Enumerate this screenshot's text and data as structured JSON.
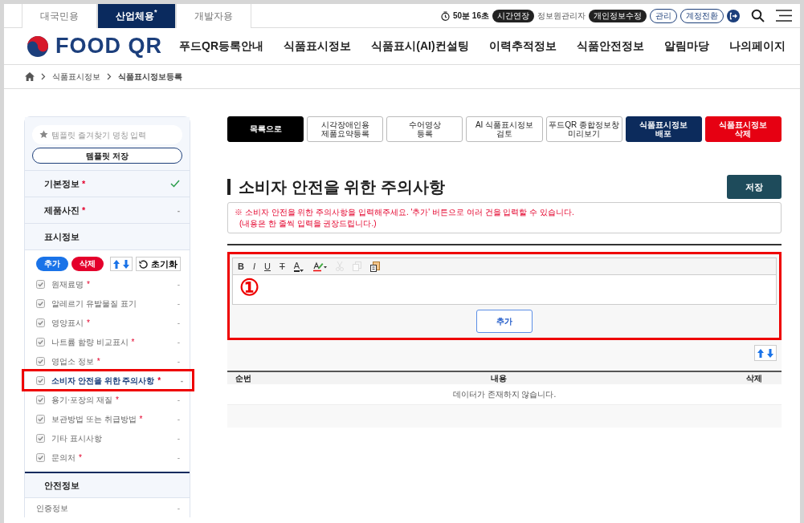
{
  "audience_tabs": [
    {
      "label": "대국민용",
      "selected": false
    },
    {
      "label": "산업체용",
      "selected": true,
      "mark": "*"
    },
    {
      "label": "개발자용",
      "selected": false
    }
  ],
  "session": {
    "timer": "50분 16초",
    "extend": "시간연장",
    "user": "정보원관리자",
    "profile": "개인정보수정",
    "links": [
      "관리",
      "계정전환"
    ]
  },
  "logo": "FOOD QR",
  "nav": [
    "푸드QR등록안내",
    "식품표시정보",
    "식품표시(AI)컨설팅",
    "이력추적정보",
    "식품안전정보",
    "알림마당",
    "나의페이지"
  ],
  "breadcrumb": [
    "식품표시정보",
    "식품표시정보등록"
  ],
  "sidebar": {
    "template_placeholder": "템플릿 즐겨찾기 명칭 입력",
    "template_save": "템플릿 저장",
    "sections": [
      {
        "label": "기본정보",
        "required_mark": "*",
        "done": true
      },
      {
        "label": "제품사진",
        "required_mark": "*",
        "done": false,
        "mark": "-"
      },
      {
        "label": "표시정보",
        "done": false,
        "tools": {
          "add": "추가",
          "remove": "삭제",
          "reset": "초기화"
        },
        "items": [
          {
            "kind": "check",
            "label": "원재료명",
            "required_mark": "*",
            "checked": true,
            "selected": false,
            "highlighted": false,
            "mark": "-"
          },
          {
            "kind": "check",
            "label": "알레르기 유발물질 표기",
            "checked": true,
            "selected": false,
            "highlighted": false,
            "mark": "-"
          },
          {
            "kind": "check",
            "label": "영양표시",
            "required_mark": "*",
            "checked": true,
            "selected": false,
            "highlighted": false,
            "mark": "-"
          },
          {
            "kind": "check",
            "label": "나트륨 함량 비교표시",
            "required_mark": "*",
            "checked": true,
            "selected": false,
            "highlighted": false,
            "mark": "-"
          },
          {
            "kind": "check",
            "label": "영업소 정보",
            "required_mark": "*",
            "checked": true,
            "selected": false,
            "highlighted": false,
            "mark": "-"
          },
          {
            "kind": "check",
            "label": "소비자 안전을 위한 주의사항",
            "required_mark": "*",
            "checked": true,
            "selected": true,
            "highlighted": true,
            "mark": "-"
          },
          {
            "kind": "check",
            "label": "용기·포장의 재질",
            "required_mark": "*",
            "checked": true,
            "selected": false,
            "highlighted": false,
            "mark": "-"
          },
          {
            "kind": "check",
            "label": "보관방법 또는 취급방법",
            "required_mark": "*",
            "checked": true,
            "selected": false,
            "highlighted": false,
            "mark": "-"
          },
          {
            "kind": "check",
            "label": "기타 표시사항",
            "checked": true,
            "selected": false,
            "highlighted": false,
            "mark": "-"
          },
          {
            "kind": "check",
            "label": "문의처",
            "required_mark": "*",
            "checked": true,
            "selected": false,
            "highlighted": false,
            "mark": "-"
          }
        ]
      },
      {
        "label": "안전정보",
        "done": false,
        "items": [
          {
            "kind": "plain",
            "label": "인증정보",
            "selected": false,
            "highlighted": false,
            "mark": "-"
          }
        ]
      }
    ]
  },
  "actions": [
    {
      "kind": "dark",
      "lines": [
        "목록으로"
      ]
    },
    {
      "kind": "outline",
      "lines": [
        "시각장애인용",
        "제품요약등록"
      ]
    },
    {
      "kind": "outline",
      "lines": [
        "수어영상",
        "등록"
      ]
    },
    {
      "kind": "outline",
      "lines": [
        "AI 식품표시정보",
        "검토"
      ]
    },
    {
      "kind": "outline",
      "lines": [
        "푸드QR 종합정보창",
        "미리보기"
      ]
    },
    {
      "kind": "navy",
      "lines": [
        "식품표시정보",
        "배포"
      ]
    },
    {
      "kind": "red",
      "lines": [
        "식품표시정보",
        "삭제"
      ]
    }
  ],
  "title": "소비자 안전을 위한 주의사항",
  "save": "저장",
  "notice": [
    "※ 소비자 안전을 위한 주의사항을 입력해주세요. '추가' 버튼으로 여러 건을 입력할 수 있습니다.",
    "(내용은 한 줄씩 입력을 권장드립니다.)"
  ],
  "editor": {
    "highlighted": true,
    "callout": "①",
    "add": "추가",
    "toolbar": [
      {
        "kind": "bold",
        "label": "B",
        "disabled": false
      },
      {
        "kind": "italic",
        "label": "I",
        "disabled": false
      },
      {
        "kind": "underline",
        "label": "U",
        "disabled": false
      },
      {
        "kind": "strike",
        "label": "T",
        "disabled": false
      },
      {
        "kind": "font-color",
        "label": "A",
        "disabled": false
      },
      {
        "kind": "highlight",
        "disabled": false
      },
      {
        "kind": "cut",
        "disabled": true
      },
      {
        "kind": "copy",
        "disabled": true
      },
      {
        "kind": "paste",
        "disabled": false
      }
    ]
  },
  "table": {
    "columns": [
      "순번",
      "내용",
      "삭제"
    ],
    "empty": "데이터가 존재하지 않습니다."
  }
}
